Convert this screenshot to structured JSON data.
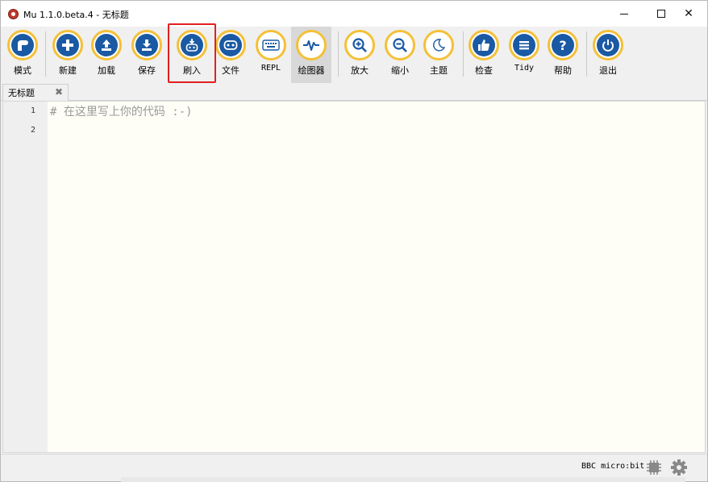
{
  "window": {
    "title": "Mu 1.1.0.beta.4 - 无标题"
  },
  "toolbar": {
    "buttons": [
      {
        "id": "mode",
        "label": "模式",
        "icon": "mu-mode-icon"
      },
      {
        "id": "new",
        "label": "新建",
        "icon": "plus-icon"
      },
      {
        "id": "load",
        "label": "加载",
        "icon": "upload-icon"
      },
      {
        "id": "save",
        "label": "保存",
        "icon": "download-icon"
      },
      {
        "id": "flash",
        "label": "刷入",
        "icon": "flash-microbit-icon"
      },
      {
        "id": "files",
        "label": "文件",
        "icon": "microbit-files-icon"
      },
      {
        "id": "repl",
        "label": "REPL",
        "icon": "keyboard-icon"
      },
      {
        "id": "plotter",
        "label": "绘图器",
        "icon": "pulse-icon"
      },
      {
        "id": "zoomin",
        "label": "放大",
        "icon": "zoom-in-icon"
      },
      {
        "id": "zoomout",
        "label": "缩小",
        "icon": "zoom-out-icon"
      },
      {
        "id": "theme",
        "label": "主题",
        "icon": "moon-icon"
      },
      {
        "id": "check",
        "label": "检查",
        "icon": "thumbs-up-icon"
      },
      {
        "id": "tidy",
        "label": "Tidy",
        "icon": "list-icon"
      },
      {
        "id": "help",
        "label": "帮助",
        "icon": "question-icon"
      },
      {
        "id": "quit",
        "label": "退出",
        "icon": "power-icon"
      }
    ]
  },
  "tabs": [
    {
      "label": "无标题",
      "close": "✖"
    }
  ],
  "editor": {
    "lines": [
      {
        "number": "1",
        "text": "#  在这里写上你的代码  :-)"
      },
      {
        "number": "2",
        "text": ""
      }
    ]
  },
  "status": {
    "mode": "BBC micro:bit"
  },
  "colors": {
    "accent_ring": "#f4c037",
    "icon_fill": "#1a59a3",
    "highlight": "#e02020",
    "editor_bg": "#fefef7"
  }
}
